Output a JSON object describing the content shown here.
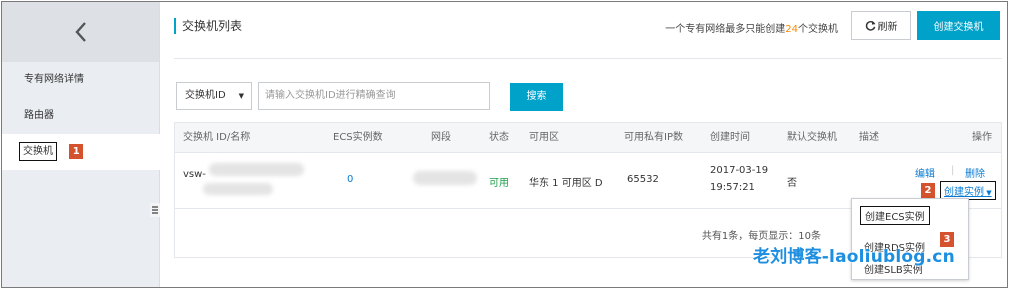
{
  "sidebar": {
    "items": [
      {
        "label": "专有网络详情"
      },
      {
        "label": "路由器"
      },
      {
        "label": "交换机"
      }
    ],
    "step_badge": "1"
  },
  "header": {
    "title": "交换机列表",
    "hint_prefix": "一个专有网络最多只能创建",
    "hint_count": "24",
    "hint_suffix": "个交换机",
    "refresh_label": "刷新",
    "create_label": "创建交换机"
  },
  "search": {
    "select_value": "交换机ID",
    "placeholder": "请输入交换机ID进行精确查询",
    "button_label": "搜索"
  },
  "table": {
    "columns": [
      "交换机 ID/名称",
      "ECS实例数",
      "网段",
      "状态",
      "可用区",
      "可用私有IP数",
      "创建时间",
      "默认交换机",
      "描述",
      "操作"
    ],
    "rows": [
      {
        "id_prefix": "vsw-",
        "ecs_count": "0",
        "status": "可用",
        "zone": "华东 1 可用区 D",
        "available_ips": "65532",
        "created_date": "2017-03-19",
        "created_time": "19:57:21",
        "default_switch": "否",
        "action_edit": "编辑",
        "action_delete": "删除",
        "action_create": "创建实例"
      }
    ],
    "footer": "共有1条，每页显示：10条"
  },
  "step_badges": {
    "two": "2",
    "three": "3"
  },
  "dropdown": {
    "items": [
      "创建ECS实例",
      "创建RDS实例",
      "创建SLB实例"
    ]
  },
  "watermark": "老刘博客-laoliublog.cn",
  "colors": {
    "accent": "#00a2ca",
    "badge": "#d4522e",
    "status_ok": "#1e9f4b",
    "link": "#0a7ad2",
    "hint_number": "#ff8a00"
  }
}
